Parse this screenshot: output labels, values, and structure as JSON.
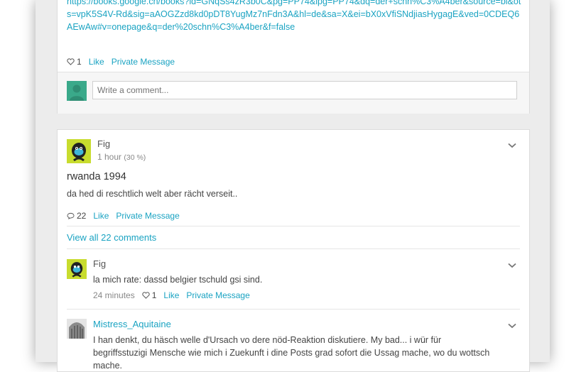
{
  "post1": {
    "url_text": "https://books.google.ch/books?id=GNqSs4zR3b0C&pg=PP74&lpg=PP74&dq=der+schn%C3%A4ber&source=bl&ots=vpK5S4V-Rd&sig=aAOGZzd8kd0pDT8YugMz7nFdn3A&hl=de&sa=X&ei=bX0xVfiSNdjiasHygagE&ved=0CDEQ6AEwAw#v=onepage&q=der%20schn%C3%A4ber&f=false",
    "like_count": "1",
    "like_label": "Like",
    "pm_label": "Private Message",
    "comment_placeholder": "Write a comment..."
  },
  "post2": {
    "author": "Fig",
    "time": "1 hour",
    "percent": "(30 %)",
    "title": "rwanda 1994",
    "body": "da hed di reschtlich welt aber rächt verseit..",
    "comment_count": "22",
    "like_label": "Like",
    "pm_label": "Private Message",
    "view_all": "View all 22 comments",
    "comments": [
      {
        "author": "Fig",
        "text": "la mich rate: dassd belgier tschuld gsi sind.",
        "time": "24 minutes",
        "like_count": "1",
        "like_label": "Like",
        "pm_label": "Private Message"
      },
      {
        "author": "Mistress_Aquitaine",
        "text": "I han denkt, du häsch welle d'Ursach vo dere nöd-Reaktion diskutiere. My bad... i wür für begriffsstuzigi Mensche wie mich i Zuekunft i dine Posts grad sofort die Ussag mache, wo du wottsch mache."
      }
    ]
  },
  "colors": {
    "accent": "#1aa3c2",
    "fig_avatar": "#c8dc2e",
    "default_avatar": "#3aa98a"
  },
  "icons": [
    "heart-icon",
    "comment-bubble-icon",
    "chevron-down-icon",
    "default-avatar-icon"
  ]
}
